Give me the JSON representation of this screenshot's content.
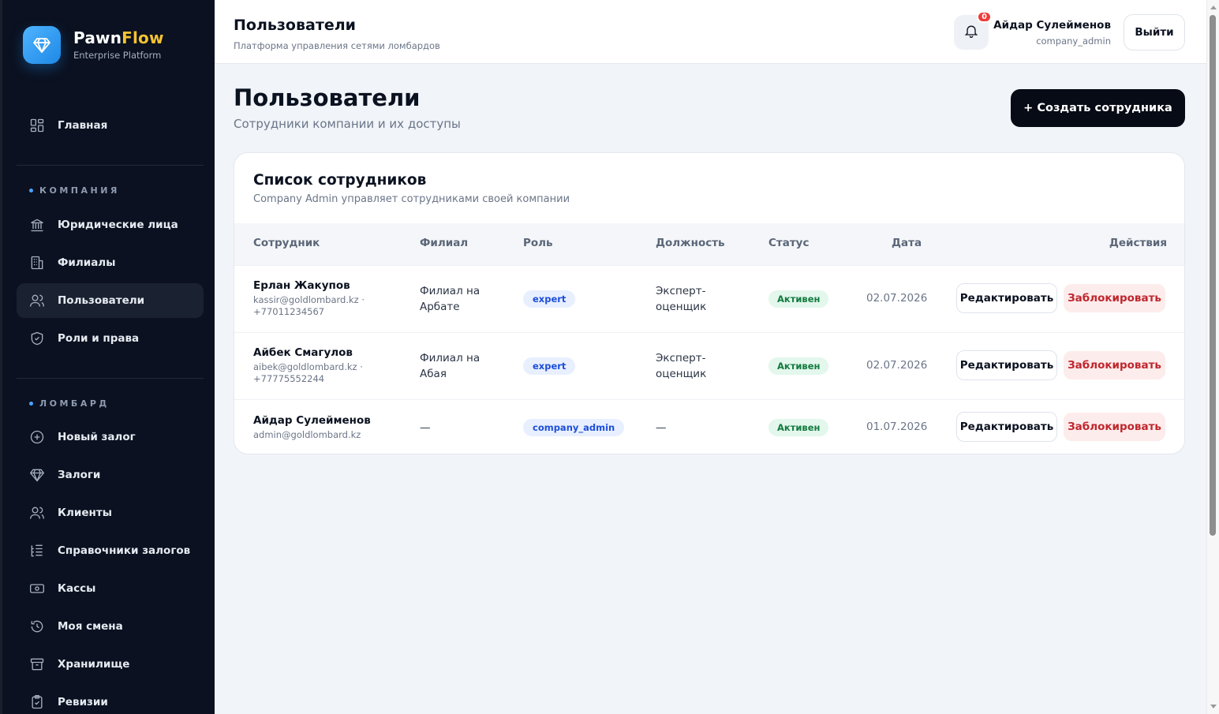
{
  "brand": {
    "name_part1": "Pawn",
    "name_part2": "Flow",
    "subtitle": "Enterprise Platform",
    "accent": "#f5c230",
    "logo_icon": "diamond-icon"
  },
  "sidebar": {
    "home": {
      "label": "Главная",
      "icon": "grid-icon"
    },
    "sections": [
      {
        "title": "КОМПАНИЯ"
      },
      {
        "title": "ЛОМБАРД"
      }
    ],
    "company_items": [
      {
        "label": "Юридические лица",
        "icon": "bank-icon"
      },
      {
        "label": "Филиалы",
        "icon": "building-icon"
      },
      {
        "label": "Пользователи",
        "icon": "users-icon",
        "active": true
      },
      {
        "label": "Роли и права",
        "icon": "shield-icon"
      }
    ],
    "pawn_items": [
      {
        "label": "Новый залог",
        "icon": "plus-circle-icon"
      },
      {
        "label": "Залоги",
        "icon": "diamond-icon"
      },
      {
        "label": "Клиенты",
        "icon": "users-icon"
      },
      {
        "label": "Справочники залогов",
        "icon": "list-tree-icon"
      },
      {
        "label": "Кассы",
        "icon": "banknote-icon"
      },
      {
        "label": "Моя смена",
        "icon": "history-icon"
      },
      {
        "label": "Хранилище",
        "icon": "archive-icon"
      },
      {
        "label": "Ревизии",
        "icon": "clipboard-check-icon"
      }
    ]
  },
  "header": {
    "title": "Пользователи",
    "subtitle": "Платформа управления сетями ломбардов",
    "notifications_count": "0",
    "user_name": "Айдар Сулейменов",
    "user_role": "company_admin",
    "logout_label": "Выйти"
  },
  "page": {
    "title": "Пользователи",
    "subtitle": "Сотрудники компании и их доступы",
    "create_label": "+ Создать сотрудника"
  },
  "table": {
    "title": "Список сотрудников",
    "subtitle": "Company Admin управляет сотрудниками своей компании",
    "columns": [
      "Сотрудник",
      "Филиал",
      "Роль",
      "Должность",
      "Статус",
      "Дата",
      "Действия"
    ],
    "rows": [
      {
        "name": "Ерлан Жакупов",
        "email": "kassir@goldlombard.kz ·",
        "phone": "+77011234567",
        "branch_line1": "Филиал на",
        "branch_line2": "Арбате",
        "role": "expert",
        "position_line1": "Эксперт-",
        "position_line2": "оценщик",
        "status": "Активен",
        "date": "02.07.2026",
        "edit": "Редактировать",
        "block": "Заблокировать"
      },
      {
        "name": "Айбек Смагулов",
        "email": "aibek@goldlombard.kz ·",
        "phone": "+77775552244",
        "branch_line1": "Филиал на",
        "branch_line2": "Абая",
        "role": "expert",
        "position_line1": "Эксперт-",
        "position_line2": "оценщик",
        "status": "Активен",
        "date": "02.07.2026",
        "edit": "Редактировать",
        "block": "Заблокировать"
      },
      {
        "name": "Айдар Сулейменов",
        "email": "admin@goldlombard.kz",
        "phone": "",
        "branch_line1": "—",
        "branch_line2": "",
        "role": "company_admin",
        "position_line1": "—",
        "position_line2": "",
        "status": "Активен",
        "date": "01.07.2026",
        "edit": "Редактировать",
        "block": "Заблокировать"
      }
    ]
  },
  "colors": {
    "sidebar_bg": "#0b1120",
    "primary_button": "#070b16",
    "role_pill": "#1d4fd8",
    "status_active": "#127a3f",
    "danger": "#c0262d",
    "badge": "#ef3b3b"
  }
}
